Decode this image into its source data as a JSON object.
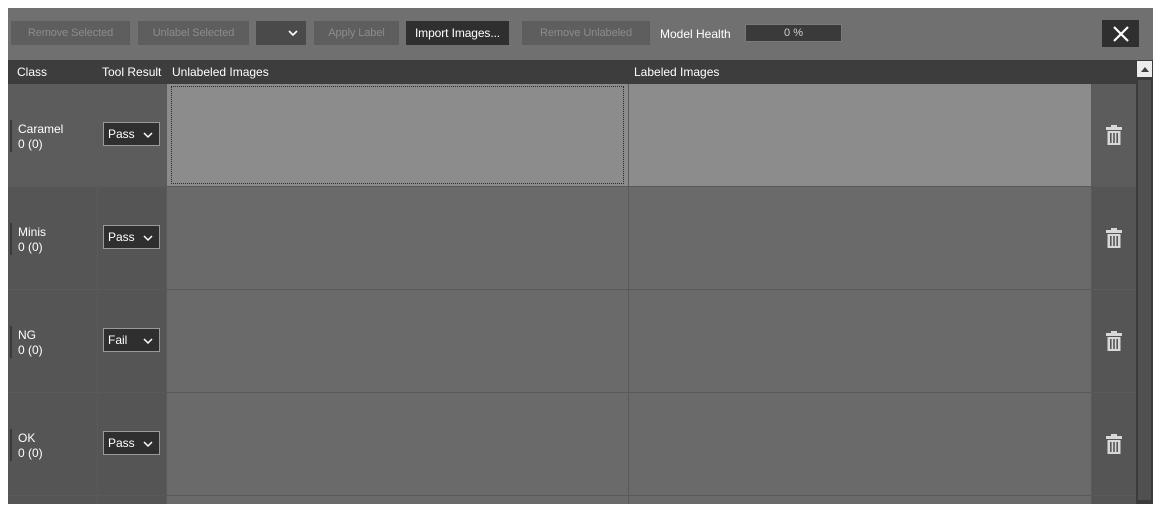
{
  "toolbar": {
    "remove_selected": "Remove Selected",
    "unlabel_selected": "Unlabel Selected",
    "label_select_value": "",
    "apply_label": "Apply Label",
    "import_images": "Import Images...",
    "remove_unlabeled": "Remove Unlabeled",
    "model_health_label": "Model Health",
    "model_health_value": "0 %",
    "model_health_progress": 0
  },
  "columns": {
    "class": "Class",
    "tool_result": "Tool Result",
    "unlabeled": "Unlabeled Images",
    "labeled": "Labeled Images"
  },
  "rows": [
    {
      "name": "Caramel",
      "count": "0 (0)",
      "tool_result": "Pass",
      "selected": true
    },
    {
      "name": "Minis",
      "count": "0 (0)",
      "tool_result": "Pass",
      "selected": false
    },
    {
      "name": "NG",
      "count": "0 (0)",
      "tool_result": "Fail",
      "selected": false
    },
    {
      "name": "OK",
      "count": "0 (0)",
      "tool_result": "Pass",
      "selected": false
    }
  ],
  "colors": {
    "panel": "#5a5a5a",
    "toolbar": "#707070",
    "selected_row": "#8c8c8c",
    "button_enabled": "#2f2f2f"
  }
}
